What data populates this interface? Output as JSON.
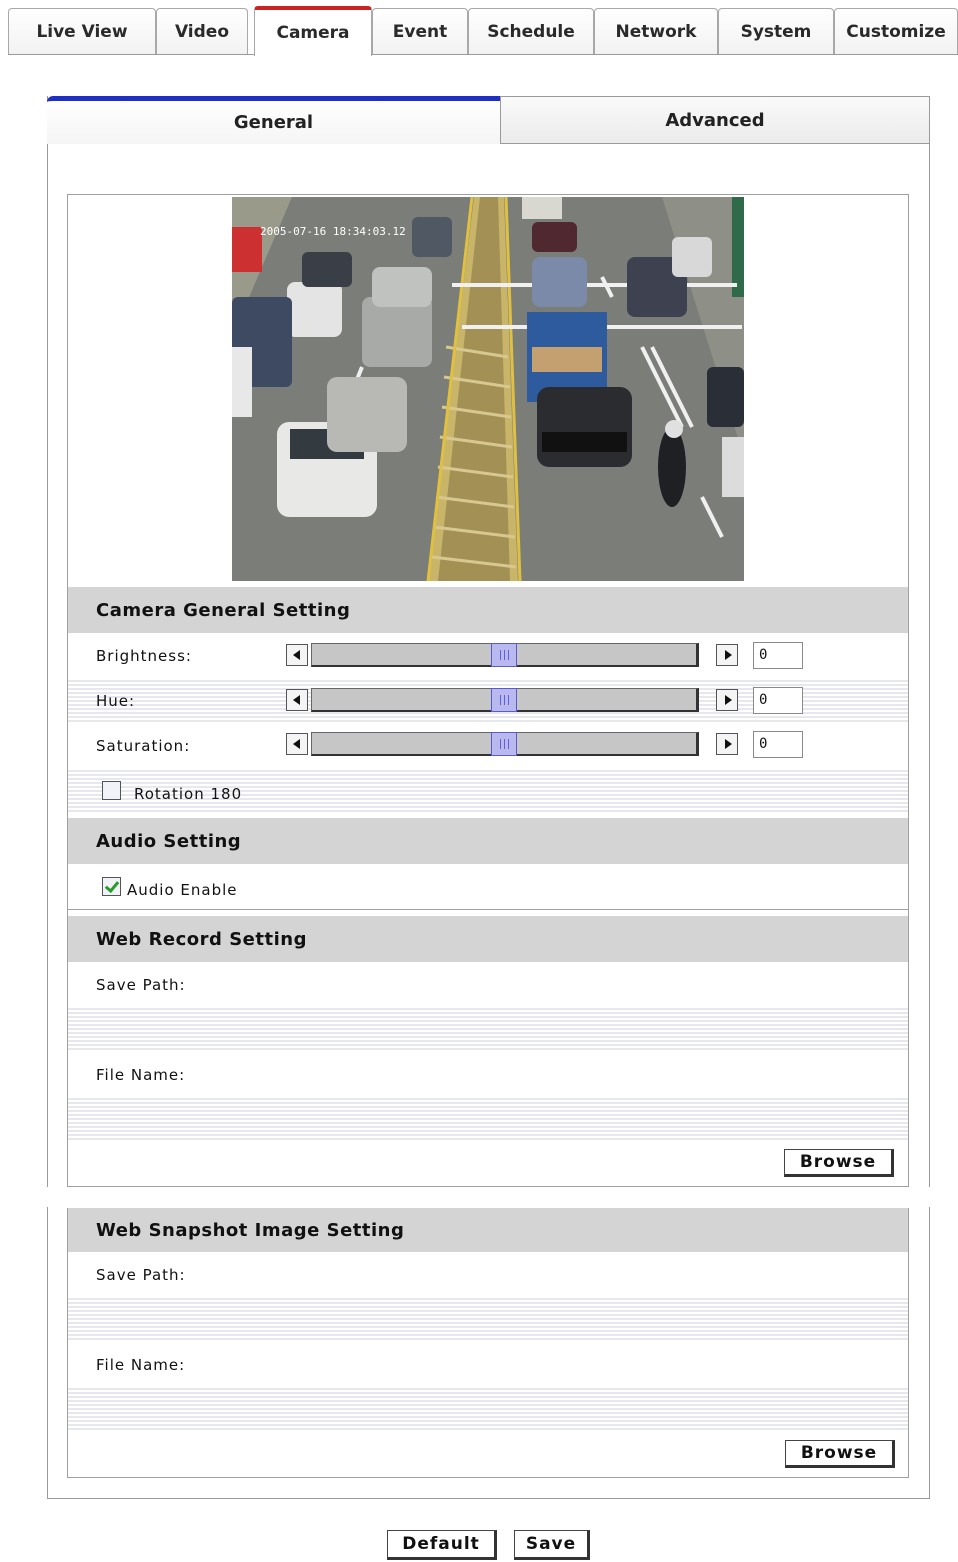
{
  "nav": {
    "tabs": [
      {
        "label": "Live View"
      },
      {
        "label": "Video"
      },
      {
        "label": "Camera",
        "active": true
      },
      {
        "label": "Event"
      },
      {
        "label": "Schedule"
      },
      {
        "label": "Network"
      },
      {
        "label": "System"
      },
      {
        "label": "Customize"
      }
    ]
  },
  "subtabs": {
    "general": "General",
    "advanced": "Advanced",
    "active": "General"
  },
  "preview": {
    "overlay_text": "2005-07-16 18:34:03.12"
  },
  "camera_general": {
    "title": "Camera General Setting",
    "brightness": {
      "label": "Brightness:",
      "value": "0",
      "level": 0.5
    },
    "hue": {
      "label": "Hue:",
      "value": "0",
      "level": 0.5
    },
    "saturation": {
      "label": "Saturation:",
      "value": "0",
      "level": 0.5
    },
    "rotation": {
      "label": "Rotation 180",
      "checked": false
    }
  },
  "audio": {
    "title": "Audio Setting",
    "enable": {
      "label": "Audio Enable",
      "checked": true
    }
  },
  "web_record": {
    "title": "Web Record Setting",
    "save_path_label": "Save Path:",
    "file_name_label": "File Name:",
    "browse": "Browse"
  },
  "web_snapshot": {
    "title": "Web Snapshot Image Setting",
    "save_path_label": "Save Path:",
    "file_name_label": "File Name:",
    "browse": "Browse"
  },
  "footer": {
    "default": "Default",
    "save": "Save"
  },
  "colors": {
    "active_tab_accent": "#cc2222",
    "subtab_accent": "#1f2fc4",
    "section_header_bg": "#d4d4d4"
  }
}
